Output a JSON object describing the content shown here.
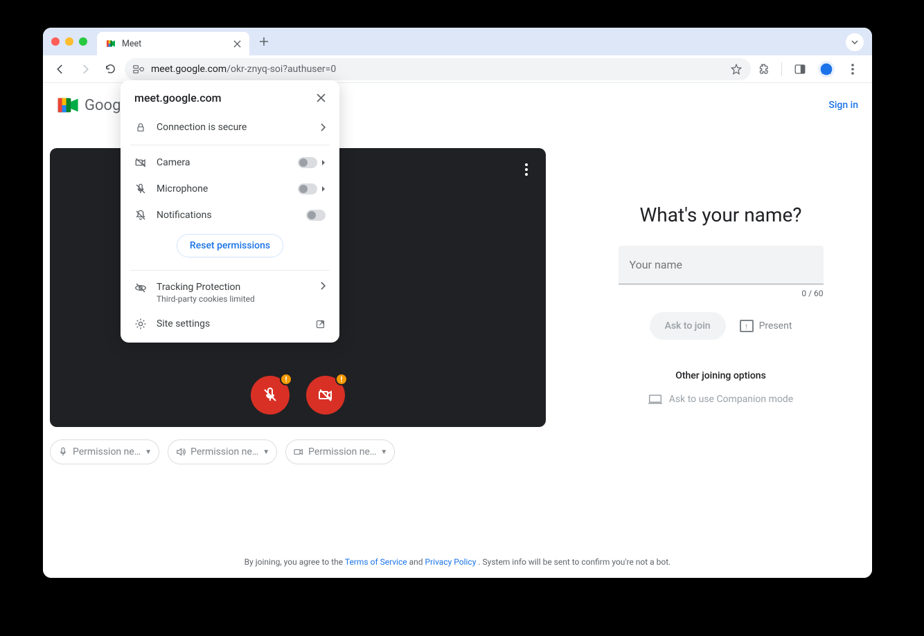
{
  "browser": {
    "tab_title": "Meet",
    "url_display_host": "meet.google.com",
    "url_display_path": "/okr-znyq-soi?authuser=0",
    "chevron_label": "▾"
  },
  "popover": {
    "site": "meet.google.com",
    "connection": "Connection is secure",
    "camera": "Camera",
    "microphone": "Microphone",
    "notifications": "Notifications",
    "reset": "Reset permissions",
    "tracking_title": "Tracking Protection",
    "tracking_sub": "Third-party cookies limited",
    "site_settings": "Site settings"
  },
  "header": {
    "product_name": "Google Meet",
    "signin": "Sign in"
  },
  "perm_chips": {
    "mic": "Permission ne…",
    "audio": "Permission ne…",
    "camera": "Permission ne…"
  },
  "join": {
    "title": "What's your name?",
    "placeholder": "Your name",
    "counter": "0 / 60",
    "ask": "Ask to join",
    "present": "Present",
    "other": "Other joining options",
    "companion": "Ask to use Companion mode"
  },
  "footer": {
    "pre": "By joining, you agree to the ",
    "tos": "Terms of Service",
    "and": " and ",
    "pp": "Privacy Policy",
    "post": ". System info will be sent to confirm you're not a bot."
  }
}
